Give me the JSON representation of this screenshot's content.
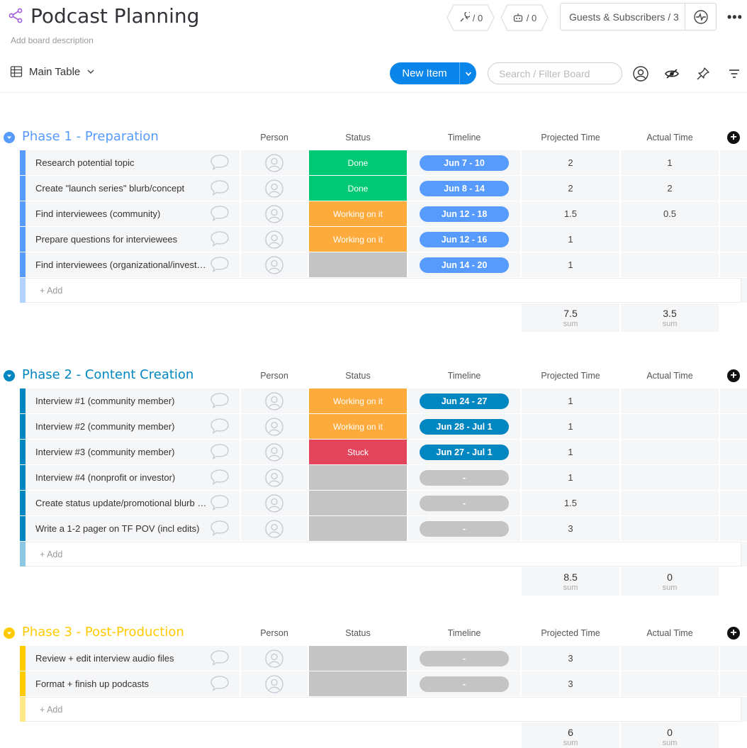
{
  "header": {
    "title": "Podcast Planning",
    "description": "Add board description",
    "integrations_count": "/ 0",
    "automations_count": "/ 0",
    "guests_label": "Guests & Subscribers / 3",
    "more": "•••"
  },
  "toolbar": {
    "view_label": "Main Table",
    "new_item_label": "New Item",
    "search_placeholder": "Search / Filter Board"
  },
  "columns": {
    "person": "Person",
    "status": "Status",
    "timeline": "Timeline",
    "projected": "Projected Time",
    "actual": "Actual Time"
  },
  "colors": {
    "done": "#00c875",
    "working": "#fdab3d",
    "stuck": "#e2445c",
    "empty": "#c4c4c4",
    "phase1": "#579bfc",
    "phase2": "#0086c0",
    "phase3": "#ffcb00"
  },
  "add_label": "+ Add",
  "sum_label": "sum",
  "groups": [
    {
      "title": "Phase 1 - Preparation",
      "color": "#579bfc",
      "timeline_color": "#579bfc",
      "rows": [
        {
          "name": "Research potential topic",
          "status": "Done",
          "status_color": "#00c875",
          "timeline": "Jun 7 - 10",
          "projected": "2",
          "actual": "1"
        },
        {
          "name": "Create \"launch series\" blurb/concept",
          "status": "Done",
          "status_color": "#00c875",
          "timeline": "Jun 8 - 14",
          "projected": "2",
          "actual": "2"
        },
        {
          "name": "Find interviewees (community)",
          "status": "Working on it",
          "status_color": "#fdab3d",
          "timeline": "Jun 12 - 18",
          "projected": "1.5",
          "actual": "0.5"
        },
        {
          "name": "Prepare questions for interviewees",
          "status": "Working on it",
          "status_color": "#fdab3d",
          "timeline": "Jun 12 - 16",
          "projected": "1",
          "actual": ""
        },
        {
          "name": "Find interviewees (organizational/investors)",
          "status": "",
          "status_color": "#c4c4c4",
          "timeline": "Jun 14 - 20",
          "projected": "1",
          "actual": ""
        }
      ],
      "sum_projected": "7.5",
      "sum_actual": "3.5"
    },
    {
      "title": "Phase 2 - Content Creation",
      "color": "#0086c0",
      "timeline_color": "#0086c0",
      "rows": [
        {
          "name": "Interview #1 (community member)",
          "status": "Working on it",
          "status_color": "#fdab3d",
          "timeline": "Jun 24 - 27",
          "projected": "1",
          "actual": ""
        },
        {
          "name": "Interview #2 (community member)",
          "status": "Working on it",
          "status_color": "#fdab3d",
          "timeline": "Jun 28 - Jul 1",
          "projected": "1",
          "actual": ""
        },
        {
          "name": "Interview #3 (community member)",
          "status": "Stuck",
          "status_color": "#e2445c",
          "timeline": "Jun 27 - Jul 1",
          "projected": "1",
          "actual": ""
        },
        {
          "name": "Interview #4 (nonprofit or investor)",
          "status": "",
          "status_color": "#c4c4c4",
          "timeline": "-",
          "projected": "1",
          "actual": ""
        },
        {
          "name": "Create status update/promotional blurb for the launch",
          "status": "",
          "status_color": "#c4c4c4",
          "timeline": "-",
          "projected": "1.5",
          "actual": ""
        },
        {
          "name": "Write a 1-2 pager on TF POV (incl edits)",
          "status": "",
          "status_color": "#c4c4c4",
          "timeline": "-",
          "projected": "3",
          "actual": ""
        }
      ],
      "sum_projected": "8.5",
      "sum_actual": "0"
    },
    {
      "title": "Phase 3 - Post-Production",
      "color": "#ffcb00",
      "timeline_color": "#c4c4c4",
      "rows": [
        {
          "name": "Review + edit interview audio files",
          "status": "",
          "status_color": "#c4c4c4",
          "timeline": "-",
          "projected": "3",
          "actual": ""
        },
        {
          "name": "Format + finish up podcasts",
          "status": "",
          "status_color": "#c4c4c4",
          "timeline": "-",
          "projected": "3",
          "actual": ""
        }
      ],
      "sum_projected": "6",
      "sum_actual": "0"
    }
  ]
}
